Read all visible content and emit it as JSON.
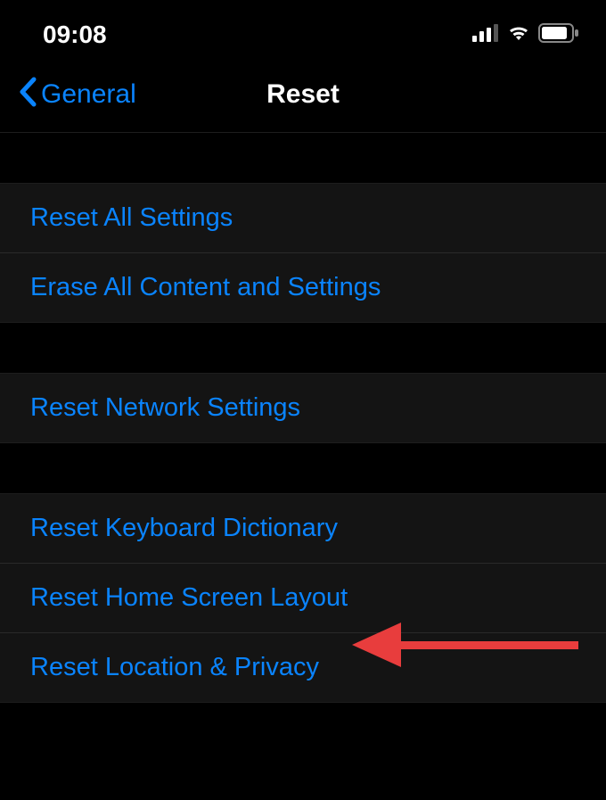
{
  "status_bar": {
    "time": "09:08"
  },
  "nav": {
    "back_label": "General",
    "title": "Reset"
  },
  "groups": {
    "g1": {
      "item1": "Reset All Settings",
      "item2": "Erase All Content and Settings"
    },
    "g2": {
      "item1": "Reset Network Settings"
    },
    "g3": {
      "item1": "Reset Keyboard Dictionary",
      "item2": "Reset Home Screen Layout",
      "item3": "Reset Location & Privacy"
    }
  }
}
